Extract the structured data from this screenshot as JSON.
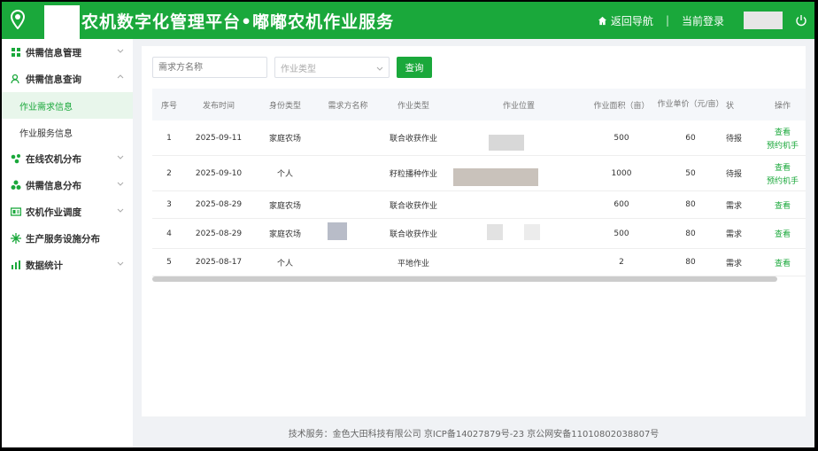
{
  "header": {
    "title": "农机数字化管理平台•嘟嘟农机作业服务",
    "home_label": "返回导航",
    "separator": "|",
    "login_label": "当前登录",
    "brand_color": "#1aa83b"
  },
  "sidebar": {
    "items": [
      {
        "label": "供需信息管理",
        "icon": "grid-icon",
        "expanded": false
      },
      {
        "label": "供需信息查询",
        "icon": "user-search-icon",
        "expanded": true,
        "children": [
          {
            "label": "作业需求信息",
            "active": true
          },
          {
            "label": "作业服务信息",
            "active": false
          }
        ]
      },
      {
        "label": "在线农机分布",
        "icon": "nodes-icon",
        "expanded": false
      },
      {
        "label": "供需信息分布",
        "icon": "cluster-icon",
        "expanded": false
      },
      {
        "label": "农机作业调度",
        "icon": "dispatch-icon",
        "expanded": false
      },
      {
        "label": "生产服务设施分布",
        "icon": "sparkle-icon"
      },
      {
        "label": "数据统计",
        "icon": "bar-chart-icon",
        "expanded": false
      }
    ]
  },
  "filters": {
    "demander_placeholder": "需求方名称",
    "work_type_placeholder": "作业类型",
    "search_label": "查询"
  },
  "table": {
    "headers": [
      "序号",
      "发布时间",
      "身份类型",
      "需求方名称",
      "作业类型",
      "作业位置",
      "作业面积（亩）",
      "作业单价（元/亩）",
      "状",
      "操作"
    ],
    "rows": [
      {
        "no": "1",
        "date": "2025-09-11",
        "identity": "家庭农场",
        "name": "",
        "work_type": "联合收获作业",
        "location": "",
        "area": "500",
        "price": "60",
        "status": "待报",
        "actions": [
          "查看",
          "预约机手"
        ]
      },
      {
        "no": "2",
        "date": "2025-09-10",
        "identity": "个人",
        "name": "",
        "work_type": "籽粒播种作业",
        "location": "",
        "area": "1000",
        "price": "50",
        "status": "待报",
        "actions": [
          "查看",
          "预约机手"
        ]
      },
      {
        "no": "3",
        "date": "2025-08-29",
        "identity": "家庭农场",
        "name": "",
        "work_type": "联合收获作业",
        "location": "",
        "area": "600",
        "price": "80",
        "status": "需求",
        "actions": [
          "查看"
        ]
      },
      {
        "no": "4",
        "date": "2025-08-29",
        "identity": "家庭农场",
        "name": "",
        "work_type": "联合收获作业",
        "location": "",
        "area": "500",
        "price": "80",
        "status": "需求",
        "actions": [
          "查看"
        ]
      },
      {
        "no": "5",
        "date": "2025-08-17",
        "identity": "个人",
        "name": "",
        "work_type": "平地作业",
        "location": "",
        "area": "2",
        "price": "80",
        "status": "需求",
        "actions": [
          "查看"
        ]
      }
    ]
  },
  "footer": {
    "text": "技术服务：金色大田科技有限公司   京ICP备14027879号-23   京公网安备11010802038807号"
  }
}
